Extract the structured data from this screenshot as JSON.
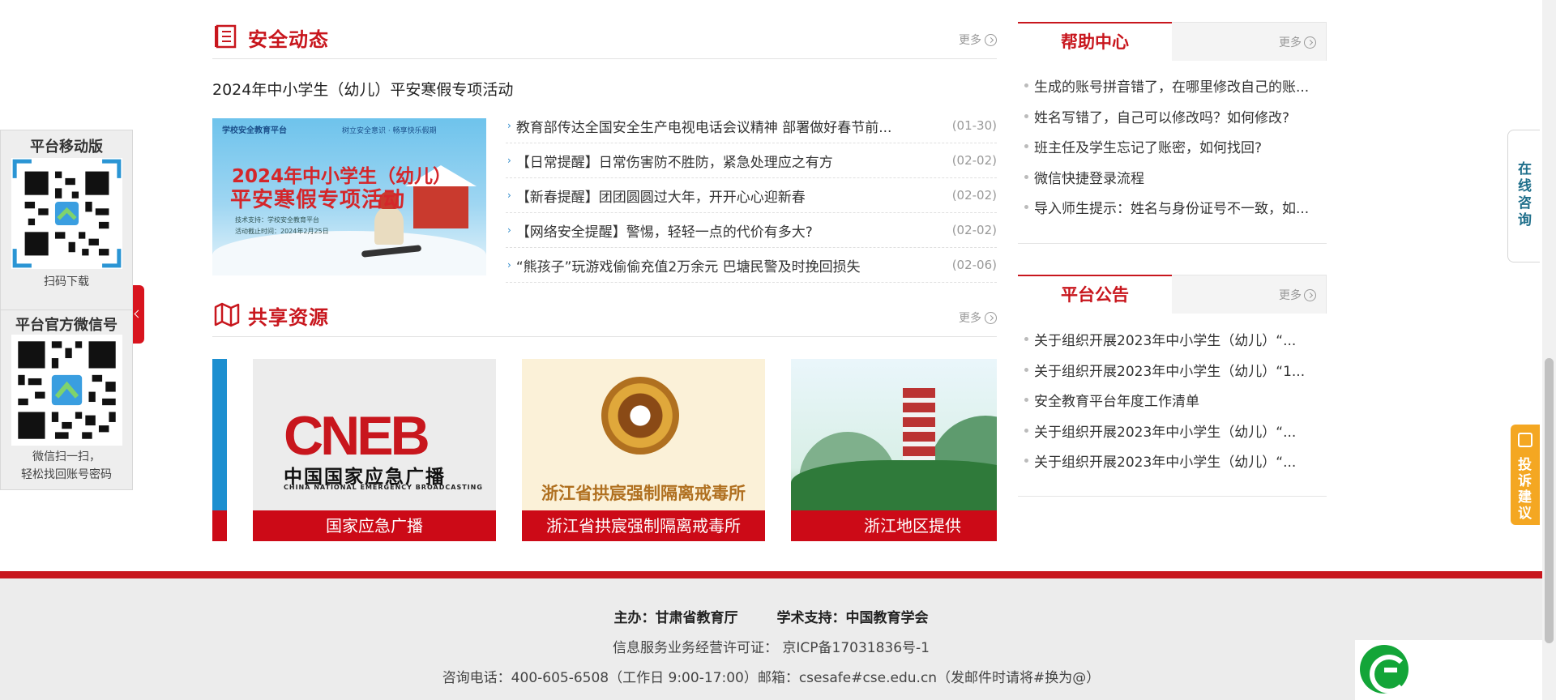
{
  "safety_news": {
    "title": "安全动态",
    "more": "更多",
    "featured_title": "2024年中小学生（幼儿）平安寒假专项活动",
    "image": {
      "logo": "学校安全教育平台",
      "slogan": "树立安全意识 · 畅享快乐假期",
      "title_line1": "2024年中小学生（幼儿）",
      "title_line2": "平安寒假专项活动",
      "support": "技术支持：学校安全教育平台",
      "deadline": "活动截止时间：2024年2月25日"
    },
    "items": [
      {
        "text": "教育部传达全国安全生产电视电话会议精神 部署做好春节前...",
        "date": "(01-30)"
      },
      {
        "text": "【日常提醒】日常伤害防不胜防，紧急处理应之有方",
        "date": "(02-02)"
      },
      {
        "text": "【新春提醒】团团圆圆过大年，开开心心迎新春",
        "date": "(02-02)"
      },
      {
        "text": "【网络安全提醒】警惕，轻轻一点的代价有多大?",
        "date": "(02-02)"
      },
      {
        "text": "“熊孩子”玩游戏偷偷充值2万余元 巴塘民警及时挽回损失",
        "date": "(02-06)"
      }
    ]
  },
  "shared_resources": {
    "title": "共享资源",
    "more": "更多",
    "slides": [
      {
        "caption": "国家应急广播",
        "logo_text": "CNEB",
        "logo_cn": "中国国家应急广播",
        "logo_en": "CHINA NATIONAL EMERGENCY BROADCASTING"
      },
      {
        "caption": "浙江省拱宸强制隔离戒毒所",
        "name": "浙江省拱宸强制隔离戒毒所"
      },
      {
        "caption": "浙江地区提供"
      }
    ]
  },
  "help_center": {
    "title": "帮助中心",
    "more": "更多",
    "items": [
      "生成的账号拼音错了，在哪里修改自己的账...",
      "姓名写错了，自己可以修改吗？如何修改?",
      "班主任及学生忘记了账密，如何找回?",
      "微信快捷登录流程",
      "导入师生提示：姓名与身份证号不一致，如..."
    ]
  },
  "announcements": {
    "title": "平台公告",
    "more": "更多",
    "items": [
      "关于组织开展2023年中小学生（幼儿）“...",
      "关于组织开展2023年中小学生（幼儿）“1...",
      "安全教育平台年度工作清单",
      "关于组织开展2023年中小学生（幼儿）“...",
      "关于组织开展2023年中小学生（幼儿）“..."
    ]
  },
  "left_float": {
    "mobile_title": "平台移动版",
    "mobile_caption": "扫码下载",
    "wechat_title": "平台官方微信号",
    "wechat_caption_1": "微信扫一扫，",
    "wechat_caption_2": "轻松找回账号密码"
  },
  "right_float": {
    "consult": "在线咨询",
    "complain": "投诉建议"
  },
  "footer": {
    "host_label": "主办：",
    "host": "甘肃省教育厅",
    "support_label": "学术支持：",
    "support": "中国教育学会",
    "license": "信息服务业务经营许可证：  京ICP备17031836号-1",
    "contact": "咨询电话：400-605-6508（工作日 9:00-17:00）邮箱：csesafe#cse.edu.cn（发邮件时请将#换为@）"
  },
  "colors": {
    "brand_red": "#c8161d",
    "link_blue": "#2b88c9",
    "complain_orange": "#f4a722"
  }
}
